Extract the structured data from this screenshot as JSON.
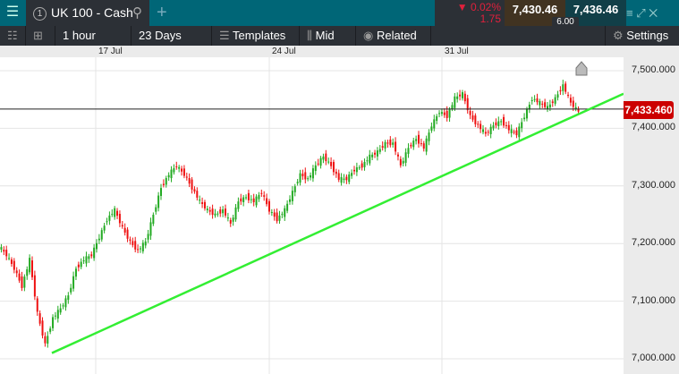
{
  "header": {
    "menu_icon": "hamburger-icon",
    "tab_number": "1",
    "instrument": "UK 100 - Cash",
    "add_tab": "+",
    "change_pct": "▼ 0.02%",
    "change_abs": "1.75",
    "sell": "7,430.46",
    "buy": "7,436.46",
    "spread": "6.00"
  },
  "toolbar": {
    "interval": "1 hour",
    "range": "23 Days",
    "templates": "Templates",
    "price_type": "Mid",
    "related": "Related",
    "settings": "Settings"
  },
  "colors": {
    "up": "#22aa22",
    "down": "#ee1111",
    "trendline": "#33ee33",
    "price_label": "#cc0000"
  },
  "chart_data": {
    "type": "candlestick",
    "x_labels": [
      {
        "label": "17 Jul",
        "index": 10
      },
      {
        "label": "24 Jul",
        "index": 30
      },
      {
        "label": "31 Jul",
        "index": 50
      }
    ],
    "y_ticks": [
      "7,500.000",
      "7,400.000",
      "7,300.000",
      "7,200.000",
      "7,100.000",
      "7,000.000"
    ],
    "ylim": [
      6996,
      7521
    ],
    "closes": [
      7196,
      7180,
      7157,
      7126,
      7172,
      7079,
      7025,
      7071,
      7087,
      7110,
      7157,
      7172,
      7180,
      7211,
      7242,
      7258,
      7227,
      7203,
      7188,
      7203,
      7250,
      7297,
      7320,
      7335,
      7320,
      7297,
      7273,
      7258,
      7250,
      7258,
      7234,
      7273,
      7281,
      7273,
      7289,
      7258,
      7242,
      7258,
      7289,
      7320,
      7312,
      7335,
      7351,
      7335,
      7312,
      7312,
      7328,
      7335,
      7351,
      7359,
      7374,
      7374,
      7335,
      7366,
      7382,
      7366,
      7405,
      7429,
      7421,
      7452,
      7460,
      7421,
      7405,
      7390,
      7405,
      7413,
      7398,
      7390,
      7421,
      7452,
      7444,
      7436,
      7452,
      7475,
      7444,
      7429
    ],
    "current_price": "7,433.460",
    "current_value": 7433.46,
    "trendline": {
      "start": 7010,
      "end": 7460
    }
  }
}
